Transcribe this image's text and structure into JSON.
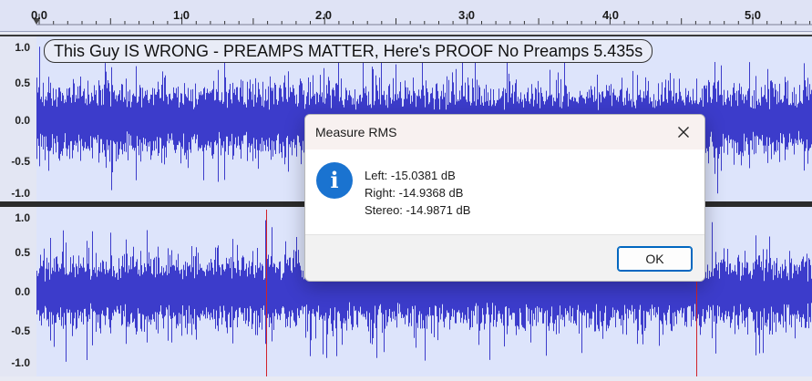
{
  "timeline": {
    "ticks": [
      "0.0",
      "1.0",
      "2.0",
      "3.0",
      "4.0",
      "5.0"
    ]
  },
  "tracks": [
    {
      "clip_name": "This Guy IS WRONG - PREAMPS MATTER, Here's PROOF No Preamps 5.435s",
      "scale_labels": [
        "1.0",
        "0.5",
        "0.0",
        "-0.5",
        "-1.0"
      ]
    },
    {
      "clip_name": "",
      "scale_labels": [
        "1.0",
        "0.5",
        "0.0",
        "-0.5",
        "-1.0"
      ]
    }
  ],
  "colors": {
    "waveform": "#3c3ccb",
    "cursor": "#d1232a",
    "track_bg": "#dde4fb"
  },
  "dialog": {
    "title": "Measure RMS",
    "close_icon": "close-icon",
    "info_icon": "info-icon",
    "info_glyph": "i",
    "lines": {
      "left": "Left: -15.0381 dB",
      "right": "Right: -14.9368 dB",
      "stereo": "Stereo: -14.9871 dB"
    },
    "ok_label": "OK"
  }
}
